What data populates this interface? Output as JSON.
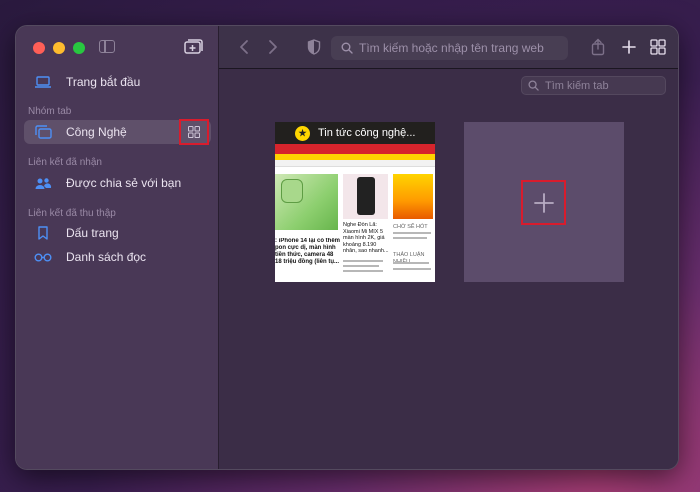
{
  "sidebar": {
    "start_page": "Trang bắt đầu",
    "tab_groups_header": "Nhóm tab",
    "tab_group_name": "Công Nghệ",
    "shared_header": "Liên kết đã nhận",
    "shared_with_you": "Được chia sẻ với bạn",
    "collected_header": "Liên kết đã thu thập",
    "bookmarks": "Dấu trang",
    "reading_list": "Danh sách đọc"
  },
  "toolbar": {
    "url_placeholder": "Tìm kiếm hoặc nhập tên trang web"
  },
  "overview": {
    "search_tabs_placeholder": "Tìm kiếm tab",
    "tab_title": "Tin tức công nghệ...",
    "thumb_headline_1": "Nghe Đồn Lã: Xiaomi Mi MIX 5 màn hình 2K, giá khoảng 8.190 nhân, sao nhanh...",
    "thumb_headline_2": ": iPhone 14 lại có thêm pon cực dị, màn hình tiền thức, camera 48 18 triệu đồng (liên tụ...",
    "thumb_side_1": "CHỜ SẼ HÓT",
    "thumb_side_2": "THẢO LUẬN NHIỀU"
  },
  "colors": {
    "accent_blue": "#4d8ff5",
    "highlight_red": "#d81c2d"
  }
}
